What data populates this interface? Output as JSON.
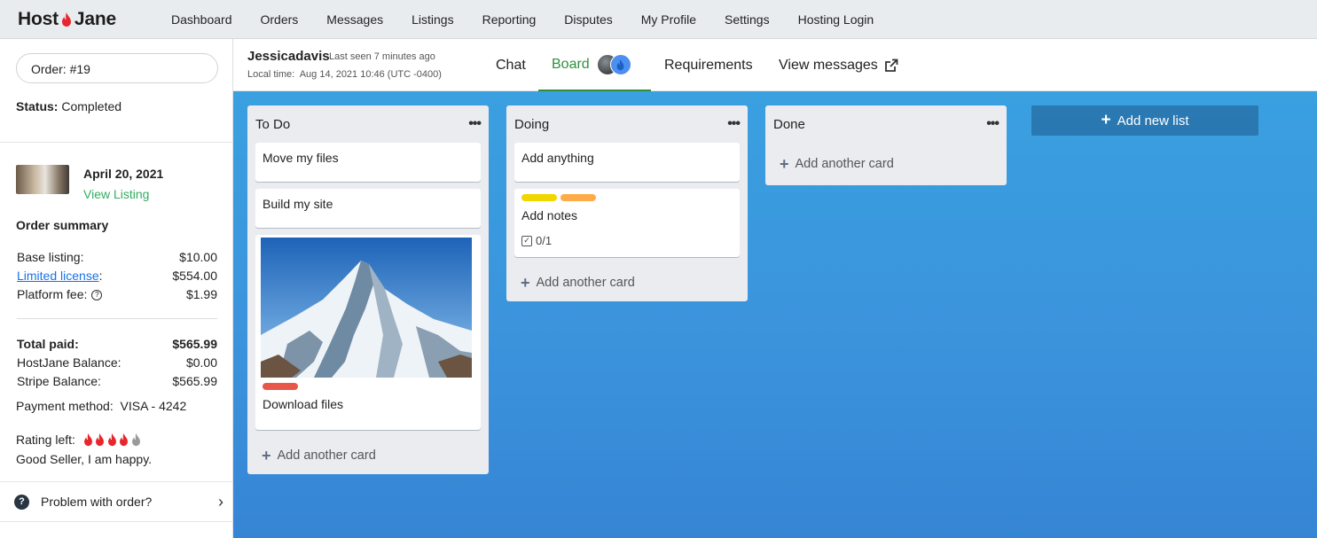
{
  "brand": {
    "name_part1": "Host",
    "name_part2": "Jane",
    "flame_color": "#e8262d"
  },
  "nav": {
    "items": [
      "Dashboard",
      "Orders",
      "Messages",
      "Listings",
      "Reporting",
      "Disputes",
      "My Profile",
      "Settings",
      "Hosting Login"
    ]
  },
  "sidebar": {
    "order_label": "Order: #19",
    "status_label": "Status:",
    "status_value": "Completed",
    "order_date": "April 20, 2021",
    "view_listing": "View Listing",
    "summary_title": "Order summary",
    "rows": [
      {
        "label": "Base listing:",
        "value": "$10.00"
      },
      {
        "label": "Limited license",
        "value": "$554.00"
      },
      {
        "label": "Platform fee:",
        "value": "$1.99"
      }
    ],
    "totals": [
      {
        "label": "Total paid:",
        "value": "$565.99"
      },
      {
        "label": "HostJane Balance:",
        "value": "$0.00"
      },
      {
        "label": "Stripe Balance:",
        "value": "$565.99"
      }
    ],
    "payment_label": "Payment method:",
    "payment_value": "VISA - 4242",
    "rating_label": "Rating left:",
    "rating_value": 4,
    "rating_max": 5,
    "review_text": "Good Seller, I am happy.",
    "problem_text": "Problem with order?"
  },
  "header": {
    "username": "Jessicadavis",
    "last_seen": "Last seen 7 minutes ago",
    "local_time_label": "Local time:",
    "local_time_value": "Aug 14, 2021 10:46 (UTC -0400)",
    "tabs": {
      "chat": "Chat",
      "board": "Board",
      "requirements": "Requirements",
      "view_messages": "View messages"
    },
    "active_tab": "Board",
    "accent_color": "#2f8f3e"
  },
  "board": {
    "lists": [
      {
        "title": "To Do",
        "cards": [
          "Move my files",
          "Build my site",
          "Download files"
        ],
        "add_label": "Add another card"
      },
      {
        "title": "Doing",
        "cards": [
          "Add anything",
          "Add notes"
        ],
        "checklist": "0/1",
        "add_label": "Add another card"
      },
      {
        "title": "Done",
        "cards": [],
        "add_label": "Add another card"
      }
    ],
    "add_list_label": "Add new list"
  }
}
